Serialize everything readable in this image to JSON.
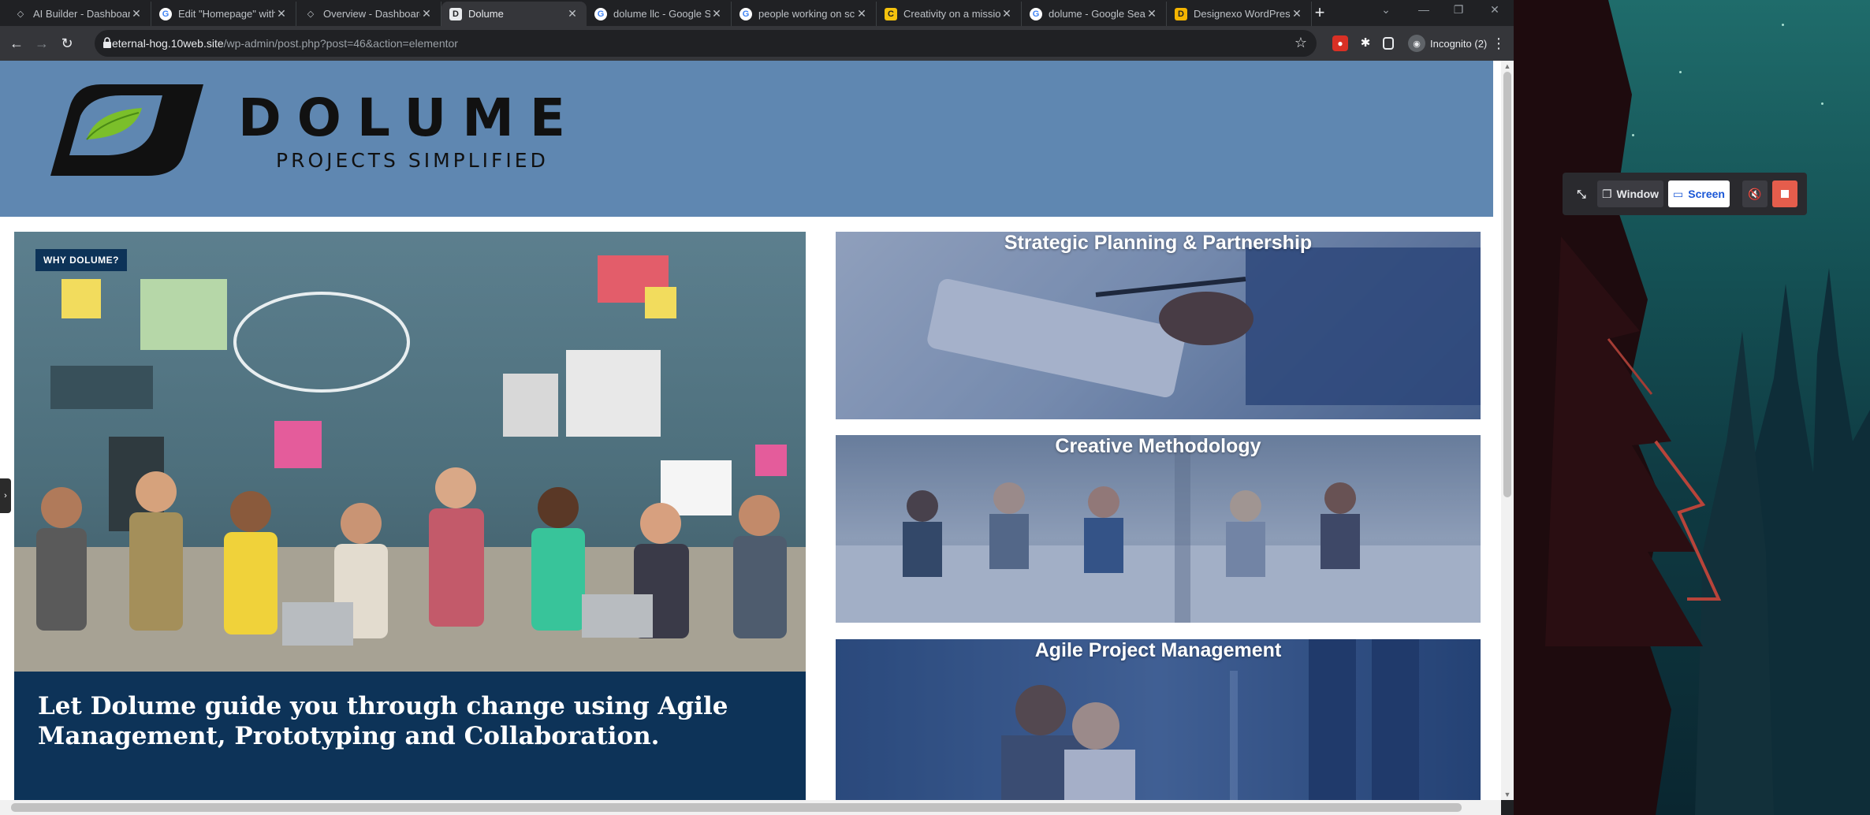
{
  "browser": {
    "tabs": [
      {
        "title": "AI Builder - Dashboard",
        "icon": "builder-icon"
      },
      {
        "title": "Edit \"Homepage\" with Elementor",
        "icon": "google-icon"
      },
      {
        "title": "Overview - Dashboard",
        "icon": "builder-icon"
      },
      {
        "title": "Dolume",
        "icon": "dolume-icon"
      },
      {
        "title": "dolume llc - Google Search",
        "icon": "google-icon"
      },
      {
        "title": "people working on screens",
        "icon": "google-icon"
      },
      {
        "title": "Creativity on a mission",
        "icon": "creativity-icon"
      },
      {
        "title": "dolume - Google Search",
        "icon": "google-icon"
      },
      {
        "title": "Designexo WordPress",
        "icon": "designexo-icon"
      }
    ],
    "new_tab_label": "+",
    "url_host": "eternal-hog.10web.site",
    "url_path": "/wp-admin/post.php?post=46&action=elementor",
    "profile_label": "Incognito (2)"
  },
  "site": {
    "logo_word": "DOLUME",
    "logo_tagline": "PROJECTS SIMPLIFIED",
    "hero": {
      "badge": "WHY DOLUME?",
      "caption": "Let Dolume guide you through change using Agile Management, Prototyping and Collaboration."
    },
    "services": [
      {
        "title": "Strategic Planning & Partnership"
      },
      {
        "title": "Creative Methodology"
      },
      {
        "title": "Agile Project Management"
      }
    ],
    "side_tab": "›"
  },
  "recorder": {
    "window_label": "Window",
    "screen_label": "Screen"
  },
  "colors": {
    "header_bg": "#5f87b1",
    "hero_navy": "#0d3358",
    "logo_green": "#7bbf2a",
    "recorder_stop": "#e55d4c"
  }
}
